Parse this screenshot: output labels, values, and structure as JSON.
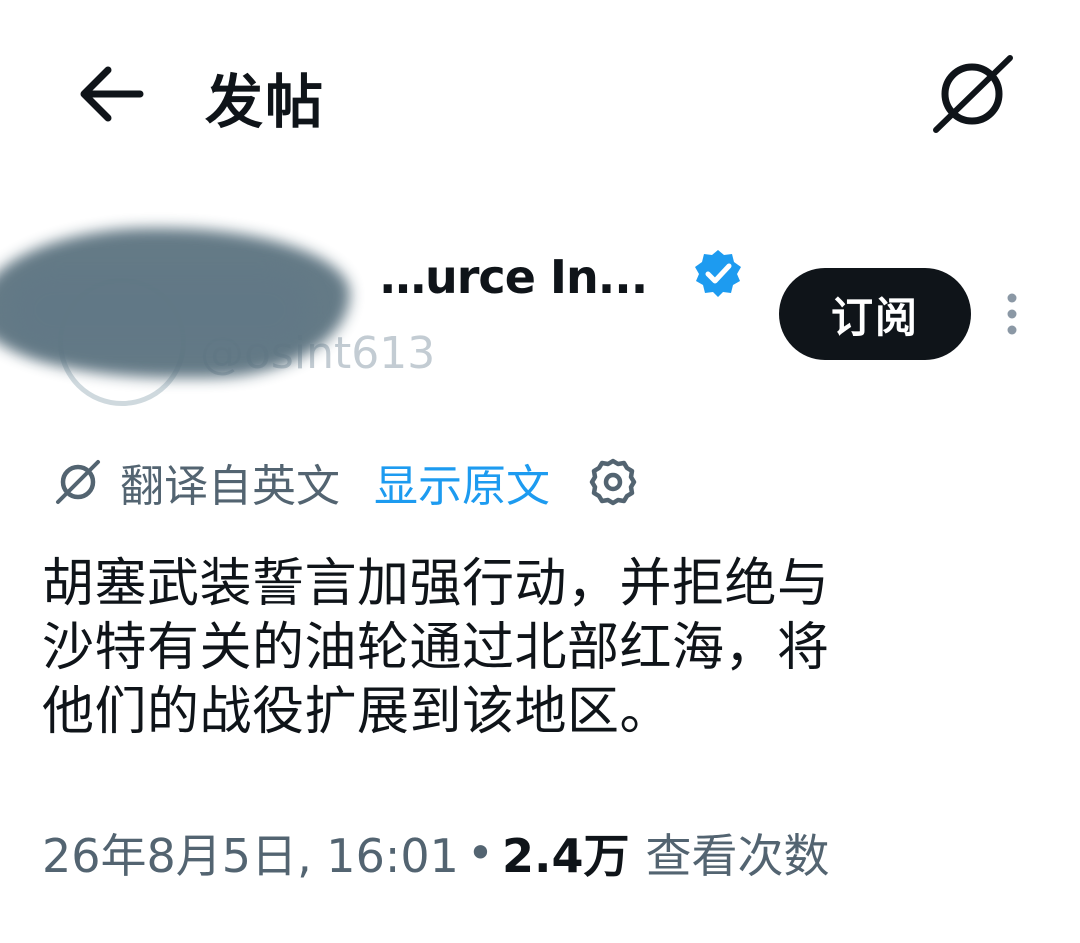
{
  "header": {
    "back_icon": "arrow-left-icon",
    "title": "发帖",
    "grok_icon": "grok-icon"
  },
  "author": {
    "name": "…urce In...",
    "handle": "@osint613",
    "verified": true,
    "verified_color": "#1d9bf0",
    "subscribe_label": "订阅",
    "more_icon": "more-vertical-icon"
  },
  "translation": {
    "label": "翻译自英文",
    "show_original": "显示原文",
    "settings_icon": "gear-icon"
  },
  "tweet": {
    "text_line1": "胡塞武装誓言加强行动，并拒绝与",
    "text_line2": "沙特有关的油轮通过北部红海，将",
    "text_line3": "他们的战役扩展到该地区。",
    "timestamp": "26年8月5日, 16:01",
    "separator": "•",
    "views": "2.4万",
    "views_label": "查看次数"
  },
  "colors": {
    "accent": "#1d9bf0",
    "text_primary": "#0f1419",
    "text_secondary": "#536471",
    "button_bg": "#0f1419"
  }
}
